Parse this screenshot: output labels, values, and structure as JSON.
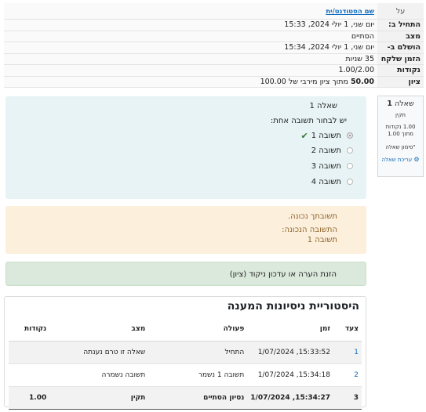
{
  "summary": {
    "rows": [
      {
        "label": "על",
        "value": "שם הסטודנט/ית",
        "is_link": true
      },
      {
        "label": "התחיל ב:",
        "value": "יום שני, 1 יולי 2024, 15:33"
      },
      {
        "label": "מצב",
        "value": "הסתיים"
      },
      {
        "label": "הושלם ב-",
        "value": "יום שני, 1 יולי 2024, 15:34"
      },
      {
        "label": "הזמן שלקח",
        "value": "35 שניות"
      },
      {
        "label": "נקודות",
        "value": "1.00/2.00"
      }
    ],
    "grade": {
      "label": "ציון",
      "value_bold": "50.00",
      "value_rest": " מתוך ציון מירבי של 100.00"
    }
  },
  "question_info": {
    "title_prefix": "שאלה",
    "number": "1",
    "state": "תקין",
    "mark_line1": "1.00 נקודות",
    "mark_line2": "מתוך 1.00",
    "flag": "\"סימון שאלה",
    "edit_label": "עריכת שאלה"
  },
  "formulation": {
    "question_text": "שאלה 1",
    "prompt": "יש לבחור תשובה אחת:",
    "answers": [
      {
        "label": "תשובה 1",
        "checked": true,
        "correct": true
      },
      {
        "label": "תשובה 2",
        "checked": false,
        "correct": false
      },
      {
        "label": "תשובה 3",
        "checked": false,
        "correct": false
      },
      {
        "label": "תשובה 4",
        "checked": false,
        "correct": false
      }
    ]
  },
  "feedback": {
    "status": "תשובתך נכונה.",
    "correct_label": "התשובה הנכונה:",
    "correct_value": "תשובה 1"
  },
  "comment": {
    "link_text": "הזנת הערה או עדכון ניקוד (ציון)"
  },
  "history": {
    "title": "היסטוריית ניסיונות המענה",
    "headers": {
      "step": "צעד",
      "time": "זמן",
      "action": "פעולה",
      "state": "מצב",
      "marks": "נקודות"
    },
    "rows": [
      {
        "step": "1",
        "time": "1/07/2024 ,15:33:52",
        "action": "התחיל",
        "state": "שאלה זו טרם נענתה",
        "marks": ""
      },
      {
        "step": "2",
        "time": "1/07/2024 ,15:34:18",
        "action": "תשובה 1 נשמר",
        "state": "תשובה נשמרה",
        "marks": ""
      },
      {
        "step": "3",
        "time": "1/07/2024 ,15:34:27",
        "action": "נסיון הסתיים",
        "state": "תקין",
        "marks": "1.00"
      }
    ]
  },
  "colors": {
    "link": "#0f6cbf",
    "formulation_bg": "#e7f3f5",
    "feedback_bg": "#fcefdc",
    "comment_bg": "#dbe9dc",
    "correct_check": "#357a32"
  }
}
